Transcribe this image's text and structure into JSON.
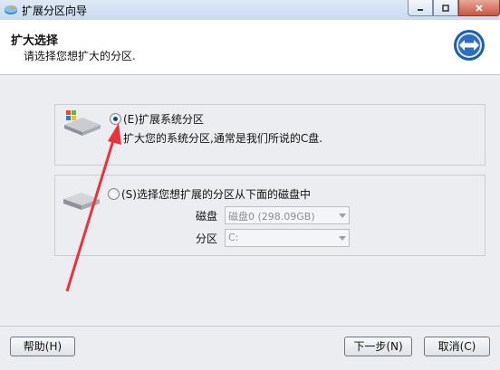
{
  "window": {
    "title": "扩展分区向导",
    "app_icon": "partition-app-icon"
  },
  "header": {
    "title": "扩大选择",
    "subtitle": "请选择您想扩大的分区.",
    "icon": "back-forward-nav-icon"
  },
  "options": [
    {
      "label": "(E)扩展系统分区",
      "description": "扩大您的系统分区,通常是我们所说的C盘.",
      "selected": true,
      "icon": "windows-drive-icon"
    },
    {
      "label": "(S)选择您想扩展的分区从下面的磁盘中",
      "selected": false,
      "icon": "hard-drive-icon",
      "disk_label": "磁盘",
      "disk_value": "磁盘0 (298.09GB)",
      "partition_label": "分区",
      "partition_value": "C:"
    }
  ],
  "footer": {
    "help": "帮助(H)",
    "next": "下一步(N)",
    "cancel": "取消(C)"
  },
  "colors": {
    "annotation_arrow": "#e8323c",
    "accent": "#1c3e8c"
  }
}
